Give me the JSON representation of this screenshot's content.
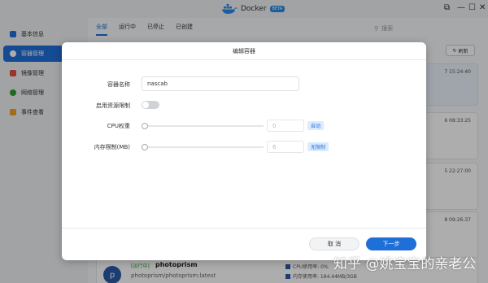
{
  "titlebar": {
    "app_title": "Docker",
    "badge": "BETA",
    "controls": [
      "⧉",
      "—",
      "☐",
      "✕"
    ]
  },
  "sidebar": {
    "items": [
      {
        "label": "基本信息",
        "icon": "info-icon",
        "color": "#1f6fd8"
      },
      {
        "label": "容器管理",
        "icon": "container-icon",
        "color": "#ffffff",
        "active": true
      },
      {
        "label": "镜像管理",
        "icon": "image-icon",
        "color": "#e0523a"
      },
      {
        "label": "网络管理",
        "icon": "network-icon",
        "color": "#2ca02c"
      },
      {
        "label": "事件查看",
        "icon": "event-icon",
        "color": "#f0a020"
      }
    ]
  },
  "main": {
    "tabs": [
      "全部",
      "运行中",
      "已停止",
      "已创建"
    ],
    "active_tab": "全部",
    "search_placeholder": "搜索",
    "refresh_label": "刷新",
    "card_timestamps": [
      "7 15:24:40",
      "6 08:33:25",
      "5 22:27:00",
      "8 09:26:37"
    ]
  },
  "photoprism_card": {
    "avatar_letter": "p",
    "status_tag": "[运行中]",
    "name": "photoprism",
    "image": "photoprism/photoprism:latest",
    "cpu_label": "CPU使用率: 0%",
    "mem_label": "内存使用率: 184.44MB/3GB"
  },
  "modal": {
    "title": "编辑容器",
    "fields": {
      "name_label": "容器名称",
      "name_value": "nascab",
      "limit_label": "启用资源限制",
      "limit_enabled": false,
      "cpu_label": "CPU权重",
      "cpu_value": "0",
      "cpu_pill": "自动",
      "mem_label": "内存限制(MB)",
      "mem_value": "6",
      "mem_pill": "无限制"
    },
    "cancel_label": "取 消",
    "next_label": "下一步"
  },
  "watermark": "知乎 @姚宝宝的亲老公",
  "colors": {
    "accent": "#1f6fd8",
    "overlay": "rgba(0,0,0,0.32)"
  }
}
